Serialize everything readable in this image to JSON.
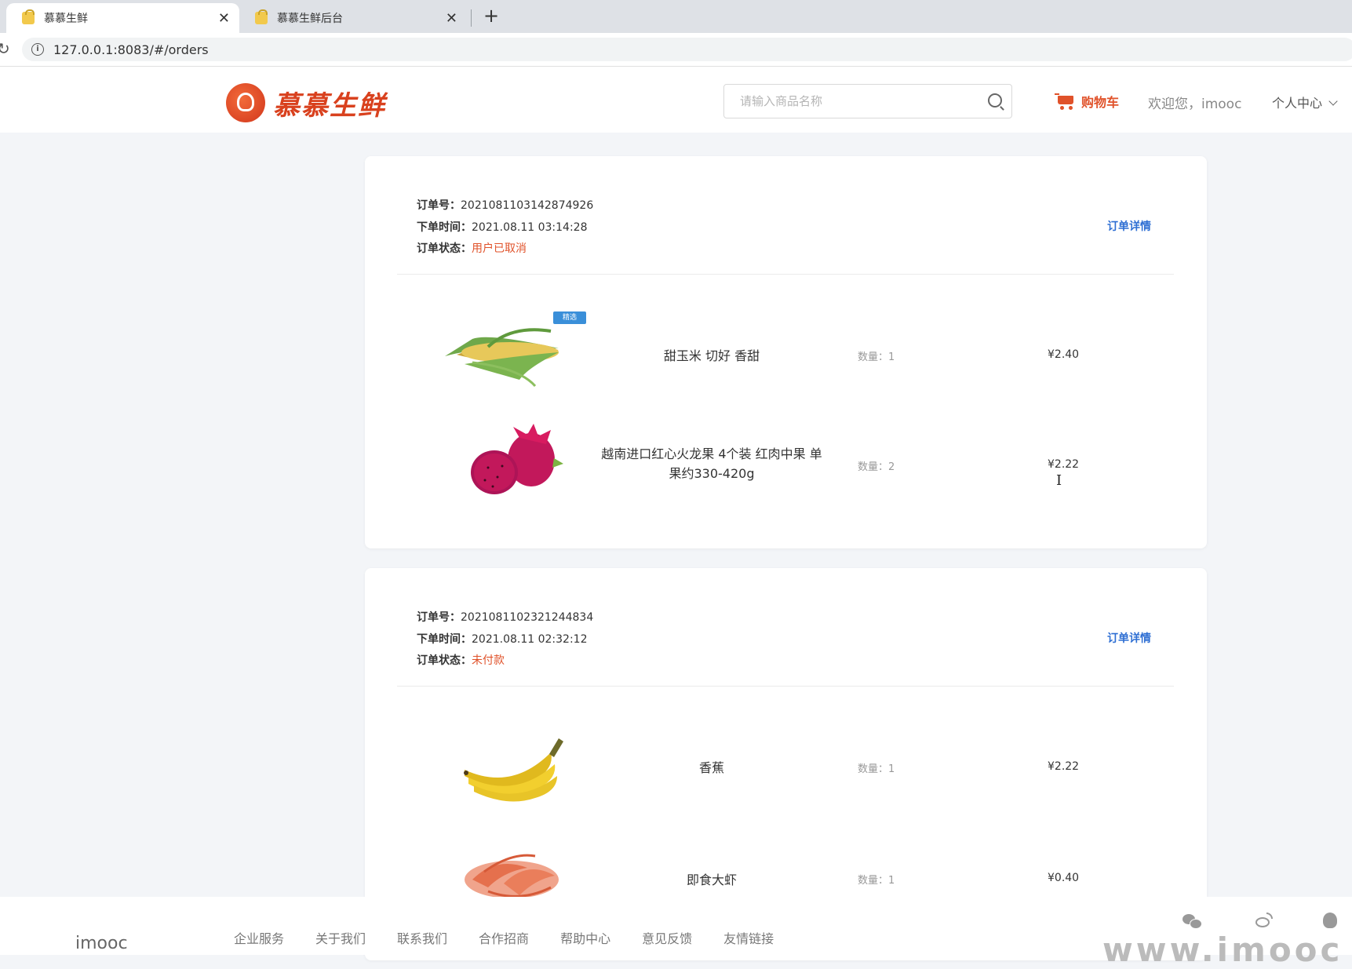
{
  "browser": {
    "tabs": [
      {
        "title": "慕慕生鲜",
        "close": "✕"
      },
      {
        "title": "慕慕生鲜后台",
        "close": "✕"
      }
    ],
    "new_tab": "+",
    "url": "127.0.0.1:8083/#/orders",
    "info_glyph": "i",
    "reload_glyph": "↻"
  },
  "header": {
    "logo_text": "慕慕生鲜",
    "search_placeholder": "请输入商品名称",
    "cart_label": "购物车",
    "welcome": "欢迎您，imooc",
    "user_center": "个人中心"
  },
  "orders": [
    {
      "no_label": "订单号：",
      "no": "2021081103142874926",
      "time_label": "下单时间：",
      "time": "2021.08.11 03:14:28",
      "status_label": "订单状态：",
      "status": "用户已取消",
      "detail_link": "订单详情",
      "items": [
        {
          "name": "甜玉米 切好 香甜",
          "qty": "数量：1",
          "price": "¥2.40",
          "badge": "精选",
          "img": "corn-image"
        },
        {
          "name": "越南进口红心火龙果 4个装 红肉中果 单果约330-420g",
          "qty": "数量：2",
          "price": "¥2.22",
          "img": "dragonfruit-image"
        }
      ]
    },
    {
      "no_label": "订单号：",
      "no": "2021081102321244834",
      "time_label": "下单时间：",
      "time": "2021.08.11 02:32:12",
      "status_label": "订单状态：",
      "status": "未付款",
      "detail_link": "订单详情",
      "items": [
        {
          "name": "香蕉",
          "qty": "数量：1",
          "price": "¥2.22",
          "img": "banana-image"
        },
        {
          "name": "即食大虾",
          "qty": "数量：1",
          "price": "¥0.40",
          "img": "shrimp-image"
        }
      ]
    }
  ],
  "footer": {
    "brand": "imooc",
    "links": [
      "企业服务",
      "关于我们",
      "联系我们",
      "合作招商",
      "帮助中心",
      "意见反馈",
      "友情链接"
    ],
    "social_icons": [
      "wechat-icon",
      "weibo-icon",
      "qq-icon"
    ],
    "watermark": "www.imooc"
  },
  "colors": {
    "accent": "#e0522a",
    "link": "#2f6fd3",
    "page_bg": "#f3f5f8"
  }
}
